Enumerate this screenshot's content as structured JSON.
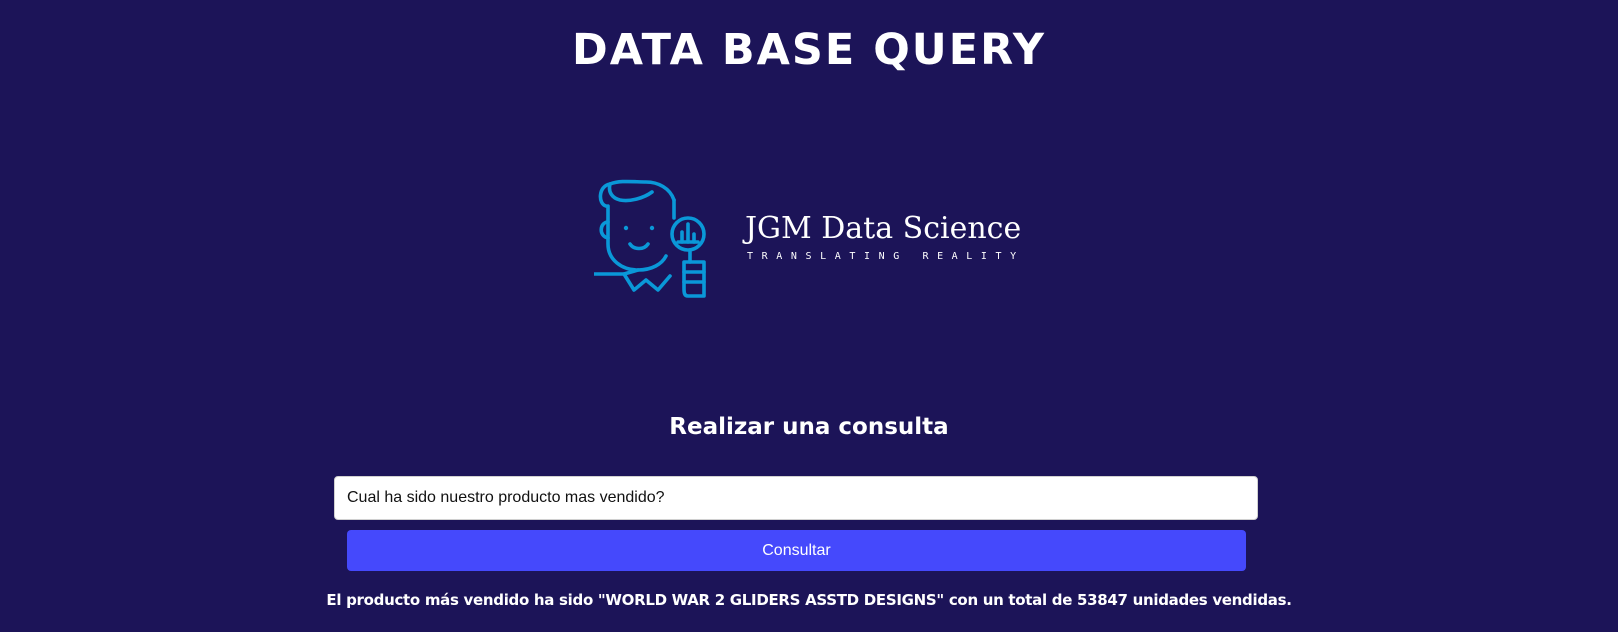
{
  "header": {
    "title": "DATA BASE QUERY"
  },
  "logo": {
    "icon": "data-scientist-mascot-icon",
    "brand_name": "JGM Data Science",
    "tagline": "TRANSLATING REALITY",
    "accent_color": "#0a98d8"
  },
  "query": {
    "heading": "Realizar una consulta",
    "input_value": "Cual ha sido nuestro producto mas vendido?",
    "button_label": "Consultar"
  },
  "result": {
    "text": "El producto más vendido ha sido \"WORLD WAR 2 GLIDERS ASSTD DESIGNS\" con un total de 53847 unidades vendidas."
  },
  "colors": {
    "background": "#1c1458",
    "button": "#4549fc"
  }
}
